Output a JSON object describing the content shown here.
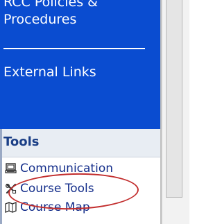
{
  "navigation": {
    "policies_label": "RCC Policies & Procedures",
    "external_links_label": "External Links"
  },
  "tools": {
    "title": "Tools",
    "items": [
      {
        "label": "Communication",
        "icon": "communication-icon"
      },
      {
        "label": "Course Tools",
        "icon": "course-tools-icon"
      },
      {
        "label": "Course Map",
        "icon": "course-map-icon"
      }
    ]
  },
  "colors": {
    "nav_blue": "#0a4cd0",
    "link_blue": "#132d8a",
    "annotation_red": "#c22d2d"
  }
}
